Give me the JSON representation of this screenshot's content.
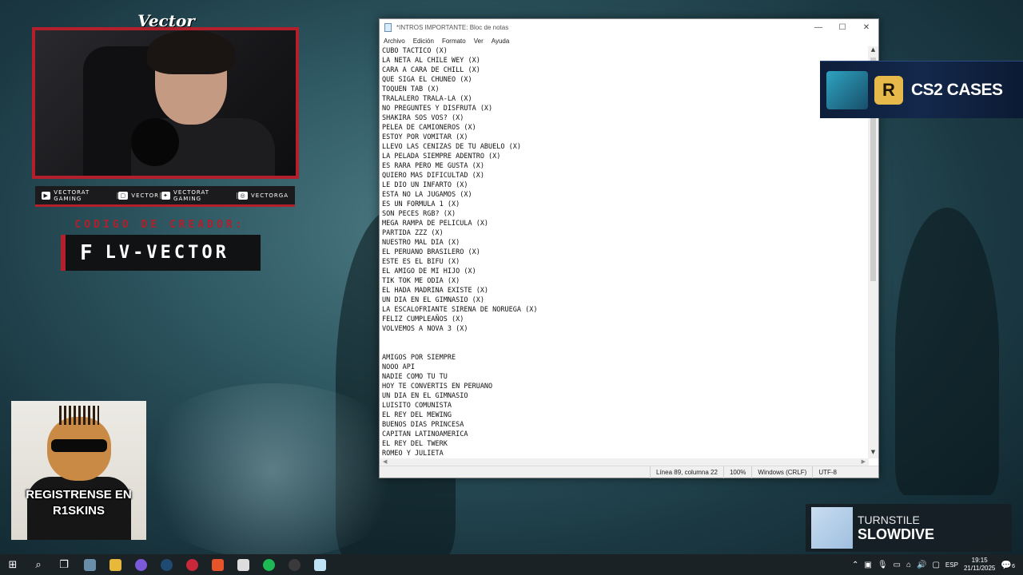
{
  "overlay": {
    "brand": "Vector",
    "socials": [
      {
        "icon": "youtube-icon",
        "label": "VECTORAT GAMING"
      },
      {
        "icon": "twitch-icon",
        "label": "VECTOR"
      },
      {
        "icon": "twitter-icon",
        "label": "VECTORAT GAMING"
      },
      {
        "icon": "instagram-icon",
        "label": "VECTORGA"
      }
    ],
    "creator_title": "CODIGO DE CREADOR:",
    "creator_code": "LV-VECTOR",
    "creator_logo": "F",
    "promo_text": "REGISTRENSE EN R1SKINS"
  },
  "notepad": {
    "title": "*INTROS IMPORTANTE: Bloc de notas",
    "menu": [
      "Archivo",
      "Edición",
      "Formato",
      "Ver",
      "Ayuda"
    ],
    "lines": [
      "CUBO TACTICO (X)",
      "LA NETA AL CHILE WEY (X)",
      "CARA A CARA DE CHILL (X)",
      "QUE SIGA EL CHUNEO (X)",
      "TOQUEN TAB (X)",
      "TRALALERO TRALA-LA (X)",
      "NO PREGUNTES Y DISFRUTA (X)",
      "SHAKIRA SOS VOS? (X)",
      "PELEA DE CAMIONEROS (X)",
      "ESTOY POR VOMITAR (X)",
      "LLEVO LAS CENIZAS DE TU ABUELO (X)",
      "LA PELADA SIEMPRE ADENTRO (X)",
      "ES RARA PERO ME GUSTA (X)",
      "QUIERO MAS DIFICULTAD (X)",
      "LE DIO UN INFARTO (X)",
      "ESTA NO LA JUGAMOS (X)",
      "ES UN FORMULA 1 (X)",
      "SON PECES RGB? (X)",
      "MEGA RAMPA DE PELICULA (X)",
      "PARTIDA ZZZ (X)",
      "NUESTRO MAL DIA (X)",
      "EL PERUANO BRASILERO (X)",
      "ESTE ES EL BIFU (X)",
      "EL AMIGO DE MI HIJO (X)",
      "TIK TOK ME ODIA (X)",
      "EL HADA MADRINA EXISTE (X)",
      "UN DIA EN EL GIMNASIO (X)",
      "LA ESCALOFRIANTE SIRENA DE NORUEGA (X)",
      "FELIZ CUMPLEAÑOS (X)",
      "VOLVEMOS A NOVA 3 (X)",
      "",
      "",
      "AMIGOS POR SIEMPRE",
      "NOOO API",
      "NADIE COMO TU TU",
      "HOY TE CONVERTIS EN PERUANO",
      "UN DIA EN EL GIMNASIO",
      "LUISITO COMUNISTA",
      "EL REY DEL MEWING",
      "BUENOS DIAS PRINCESA",
      "CAPITAN LATINOAMERICA",
      "EL REY DEL TWERK",
      "ROMEO Y JULIETA"
    ],
    "status": {
      "position": "Línea 89, columna 22",
      "zoom": "100%",
      "line_ending": "Windows (CRLF)",
      "encoding": "UTF-8"
    }
  },
  "cs2_ad": {
    "logo": "R",
    "label": "CS2 CASES"
  },
  "now_playing": {
    "artist": "TURNSTILE",
    "track": "SLOWDIVE"
  },
  "taskbar": {
    "lang": "ESP",
    "time": "19:15",
    "date": "21/11/2025",
    "notification_count": "6"
  },
  "colors": {
    "accent_red": "#b31f2a",
    "notepad_bg": "#ffffff",
    "taskbar_bg": "#1b2226"
  }
}
